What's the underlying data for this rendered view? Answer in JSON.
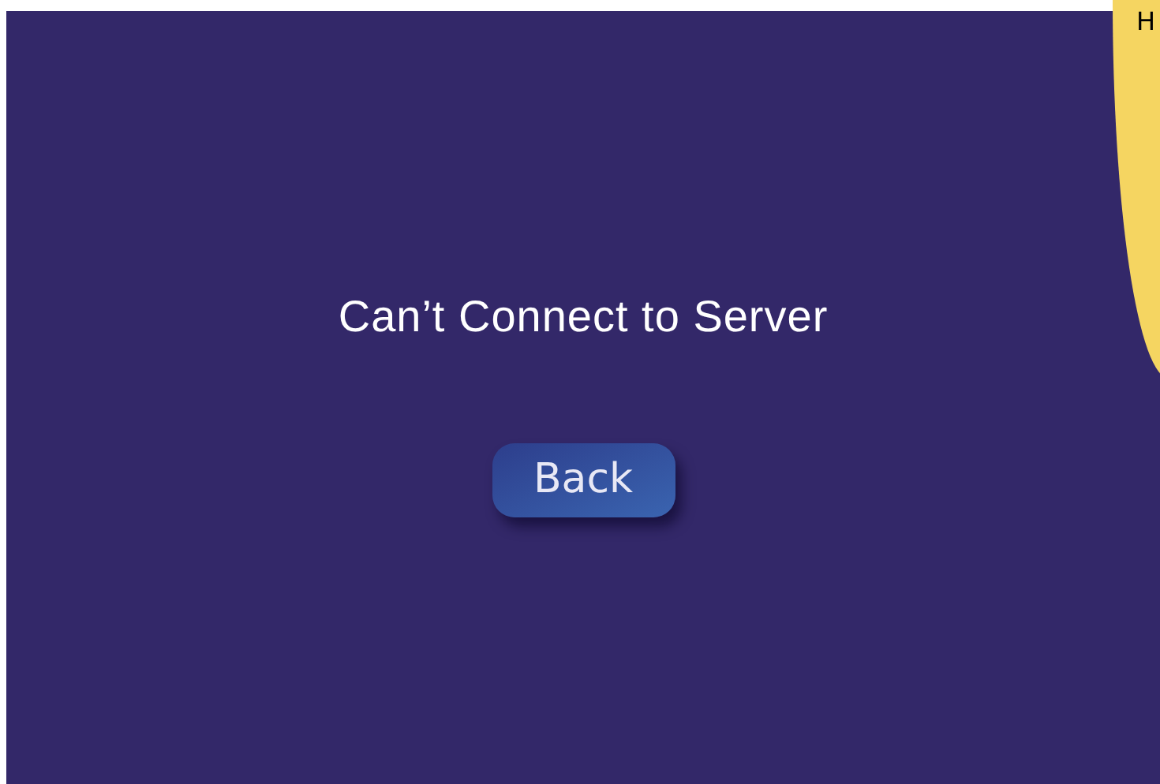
{
  "message": "Can’t Connect to Server",
  "back_button": {
    "label": "Back"
  },
  "side_note": {
    "text": "H"
  }
}
